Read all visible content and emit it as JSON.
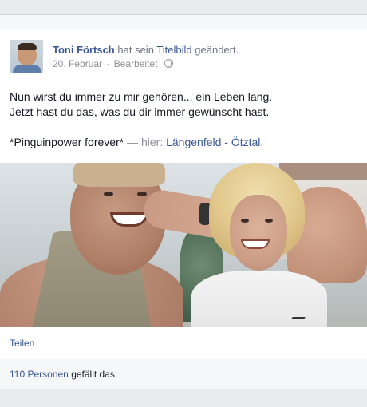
{
  "post": {
    "author_name": "Toni Förtsch",
    "action_text": "hat sein",
    "action_link": "Titelbild",
    "action_suffix": "geändert.",
    "date": "20. Februar",
    "meta_separator": "·",
    "edited_label": "Bearbeitet",
    "privacy_icon": "globe-icon",
    "text_line1": "Nun wirst du immer zu mir gehören... ein Leben lang.",
    "text_line2": "Jetzt hast du das, was du dir immer gewünscht hast.",
    "text_tag": "*Pinguinpower forever*",
    "place_dash": "—",
    "place_prefix": "hier:",
    "place_name": "Längenfeld - Ötztal."
  },
  "actions": {
    "share_label": "Teilen"
  },
  "likes": {
    "count_label": "110 Personen",
    "suffix": "gefällt das."
  },
  "colors": {
    "link": "#3b5998",
    "text": "#141823",
    "meta": "#8b8f97",
    "page_background": "#e9ebee"
  }
}
